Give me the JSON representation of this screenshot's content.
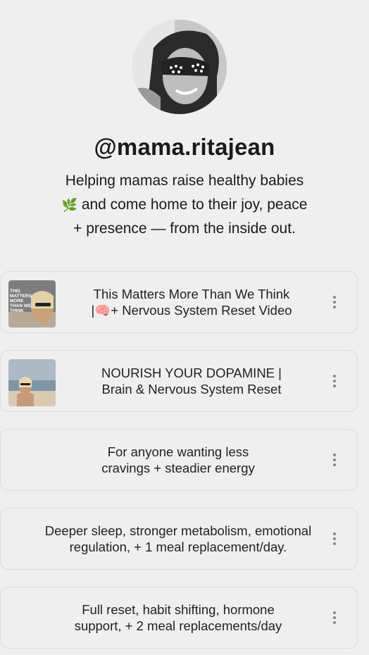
{
  "profile": {
    "handle": "@mama.ritajean",
    "bio_line1": "Helping mamas raise healthy babies",
    "bio_leaf": "🌿",
    "bio_line2": "and come home to their joy, peace",
    "bio_line3": "+ presence — from the inside out.",
    "avatar_icon": "profile-photo"
  },
  "links": [
    {
      "line1": "This Matters More Than We Think",
      "line2": "|🧠+ Nervous System Reset Video",
      "thumb_text": "THIS MATTERS MORE THAN WE THINK",
      "menu_icon": "more-vertical-icon"
    },
    {
      "line1": "NOURISH YOUR DOPAMINE |",
      "line2": "Brain & Nervous System Reset",
      "menu_icon": "more-vertical-icon"
    },
    {
      "line1": "For anyone wanting less",
      "line2": "cravings + steadier energy",
      "menu_icon": "more-vertical-icon"
    },
    {
      "line1": "Deeper sleep, stronger metabolism, emotional",
      "line2": "regulation, + 1 meal replacement/day.",
      "menu_icon": "more-vertical-icon"
    },
    {
      "line1": "Full reset, habit shifting, hormone",
      "line2": "support, + 2 meal replacements/day",
      "menu_icon": "more-vertical-icon"
    }
  ]
}
